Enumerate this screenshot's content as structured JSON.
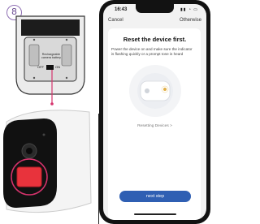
{
  "step": {
    "number": "8"
  },
  "battery_diagram": {
    "label_line1": "Rechargeable",
    "label_line2": "camera battery",
    "off_label": "OFF",
    "on_label": "ON"
  },
  "phone": {
    "status": {
      "time": "16:43"
    },
    "nav": {
      "cancel": "Cancel",
      "otherwise": "Otherwise"
    },
    "title": "Reset the device first.",
    "description": "Power the device on and make sure the indicator is flashing quickly or a prompt tone is heard",
    "resetting_link": "Resetting Devices >",
    "next_button": "next step"
  },
  "colors": {
    "accent_button": "#2f5fb3",
    "highlight_pink": "#d6336c",
    "camera_red": "#e8333c",
    "step_badge": "#8e6fb3"
  }
}
